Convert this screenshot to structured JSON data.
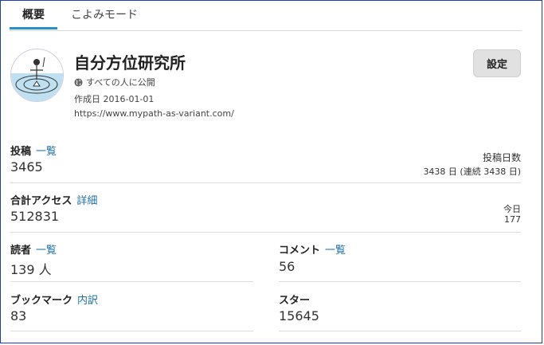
{
  "tabs": [
    {
      "label": "概要"
    },
    {
      "label": "こよみモード"
    }
  ],
  "blog": {
    "title": "自分方位研究所",
    "visibility": "すべての人に公開",
    "created": "作成日 2016-01-01",
    "url": "https://www.mypath-as-variant.com/",
    "settings_label": "設定"
  },
  "stats": {
    "posts": {
      "label": "投稿",
      "link": "一覧",
      "value": "3465",
      "days_label": "投稿日数",
      "days_value": "3438 日 (連続 3438 日)"
    },
    "access": {
      "label": "合計アクセス",
      "link": "詳細",
      "value": "512831",
      "today_label": "今日",
      "today_value": "177"
    },
    "readers": {
      "label": "読者",
      "link": "一覧",
      "value": "139 人"
    },
    "comments": {
      "label": "コメント",
      "link": "一覧",
      "value": "56"
    },
    "bookmarks": {
      "label": "ブックマーク",
      "link": "内訳",
      "value": "83"
    },
    "stars": {
      "label": "スター",
      "value": "15645"
    }
  },
  "icons": {
    "globe": "globe-icon",
    "avatar": "blog-avatar"
  },
  "colors": {
    "link": "#1d6fa8",
    "tab_accent": "#2b8fcc",
    "frame": "#1a3fb0"
  }
}
